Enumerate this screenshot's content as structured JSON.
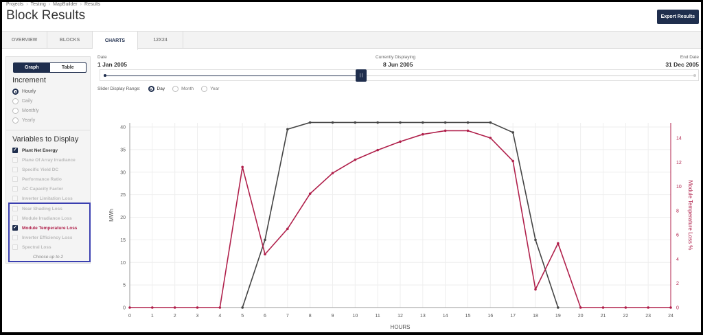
{
  "breadcrumb": [
    "Projects",
    "Testing",
    "MapBuilder",
    "Results"
  ],
  "title": "Block Results",
  "export_label": "Export Results",
  "tabs": [
    {
      "label": "OVERVIEW",
      "active": false
    },
    {
      "label": "BLOCKS",
      "active": false
    },
    {
      "label": "CHARTS",
      "active": true
    },
    {
      "label": "12X24",
      "active": false
    }
  ],
  "view_toggle": {
    "graph": "Graph",
    "table": "Table",
    "selected": "Graph"
  },
  "increment": {
    "title": "Increment",
    "options": [
      "Hourly",
      "Daily",
      "Monthly",
      "Yearly"
    ],
    "selected": "Hourly"
  },
  "variables": {
    "title": "Variables to Display",
    "items": [
      {
        "label": "Plant Net Energy",
        "checked": true
      },
      {
        "label": "Plane Of Array Irradiance",
        "checked": false
      },
      {
        "label": "Specific Yield DC",
        "checked": false
      },
      {
        "label": "Performance Ratio",
        "checked": false
      },
      {
        "label": "AC Capacity Factor",
        "checked": false
      },
      {
        "label": "Inverter Limitation Loss",
        "checked": false
      },
      {
        "label": "Near Shading Loss",
        "checked": false
      },
      {
        "label": "Module Irradiance Loss",
        "checked": false
      },
      {
        "label": "Module Temperature Loss",
        "checked": true
      },
      {
        "label": "Inverter Efficiency Loss",
        "checked": false
      },
      {
        "label": "Spectral Loss",
        "checked": false
      }
    ],
    "hint": "Choose up to 2"
  },
  "date_slider": {
    "start_label": "Date",
    "start_value": "1 Jan 2005",
    "current_label": "Currently Displaying",
    "current_value": "8 Jun 2005",
    "end_label": "End Date",
    "end_value": "31 Dec 2005",
    "position_fraction": 0.43,
    "thumb_glyph": "| |"
  },
  "range": {
    "label": "Slider Display Range:",
    "options": [
      "Day",
      "Month",
      "Year"
    ],
    "selected": "Day"
  },
  "colors": {
    "accent": "#1f2e4d",
    "series_energy": "#444444",
    "series_temp": "#b0204b",
    "highlight": "#3a3fb0"
  },
  "chart_data": {
    "type": "line",
    "xlabel": "HOURS",
    "ylabel": "MWh",
    "y2label": "Module Temperature Loss %",
    "x": [
      0,
      1,
      2,
      3,
      4,
      5,
      6,
      7,
      8,
      9,
      10,
      11,
      12,
      13,
      14,
      15,
      16,
      17,
      18,
      19,
      20,
      21,
      22,
      23,
      24
    ],
    "xlim": [
      0,
      24
    ],
    "ylim": [
      0,
      40
    ],
    "y2lim": [
      0,
      14
    ],
    "yticks": [
      0,
      5,
      10,
      15,
      20,
      25,
      30,
      35,
      40
    ],
    "y2ticks": [
      0,
      2,
      4,
      6,
      8,
      10,
      12,
      14
    ],
    "grid": true,
    "series": [
      {
        "name": "Plant Net Energy",
        "axis": "left",
        "x": [
          5,
          6,
          7,
          8,
          9,
          10,
          11,
          12,
          13,
          14,
          15,
          16,
          17,
          18,
          19
        ],
        "values": [
          0,
          15,
          39.5,
          41,
          41,
          41,
          41,
          41,
          41,
          41,
          41,
          41,
          38.8,
          15,
          0
        ]
      },
      {
        "name": "Module Temperature Loss",
        "axis": "right",
        "x": [
          0,
          1,
          2,
          3,
          4,
          5,
          6,
          7,
          8,
          9,
          10,
          11,
          12,
          13,
          14,
          15,
          16,
          17,
          18,
          19,
          20,
          21,
          22,
          23,
          24
        ],
        "values": [
          0,
          0,
          0,
          0,
          0,
          11.6,
          4.4,
          6.5,
          9.4,
          11.1,
          12.2,
          13,
          13.7,
          14.3,
          14.6,
          14.6,
          14,
          12.1,
          1.5,
          5.3,
          0,
          0,
          0,
          0,
          0
        ]
      }
    ]
  }
}
